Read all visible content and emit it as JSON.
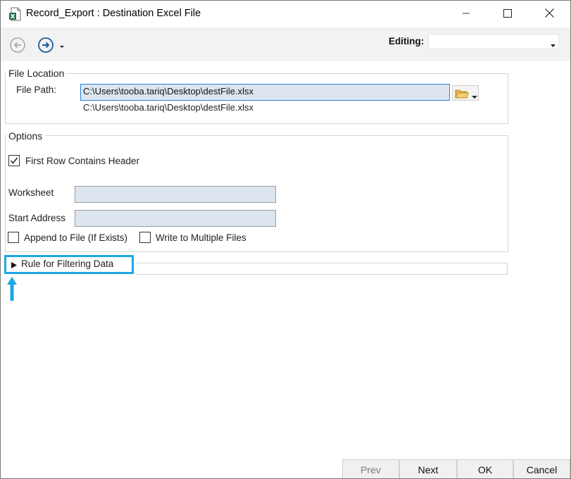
{
  "window": {
    "title": "Record_Export : Destination Excel File",
    "app_icon": "excel-file-icon",
    "controls": {
      "minimize": "minimize-icon",
      "maximize": "maximize-icon",
      "close": "close-icon"
    }
  },
  "toolbar": {
    "back_icon": "back-arrow-icon",
    "forward_icon": "forward-arrow-icon",
    "editing_label": "Editing:",
    "editing_value": ""
  },
  "file_location": {
    "legend": "File Location",
    "file_path_label": "File Path:",
    "file_path_value": "C:\\Users\\tooba.tariq\\Desktop\\destFile.xlsx",
    "resolved_path": "C:\\Users\\tooba.tariq\\Desktop\\destFile.xlsx",
    "browse_icon": "folder-icon"
  },
  "options": {
    "legend": "Options",
    "first_row_header_label": "First Row Contains Header",
    "first_row_header_checked": true,
    "worksheet_label": "Worksheet",
    "worksheet_value": "",
    "start_address_label": "Start Address",
    "start_address_value": "",
    "append_label": "Append to File (If Exists)",
    "append_checked": false,
    "multiple_files_label": "Write to Multiple Files",
    "multiple_files_checked": false
  },
  "rule": {
    "label": "Rule for Filtering Data",
    "expanded": false,
    "highlight_color": "#1ea7e6"
  },
  "buttons": {
    "prev": "Prev",
    "next": "Next",
    "ok": "OK",
    "cancel": "Cancel"
  },
  "colors": {
    "field_bg": "#dde6ef",
    "accent": "#2a7ee0",
    "annotation": "#1ea7e6"
  }
}
